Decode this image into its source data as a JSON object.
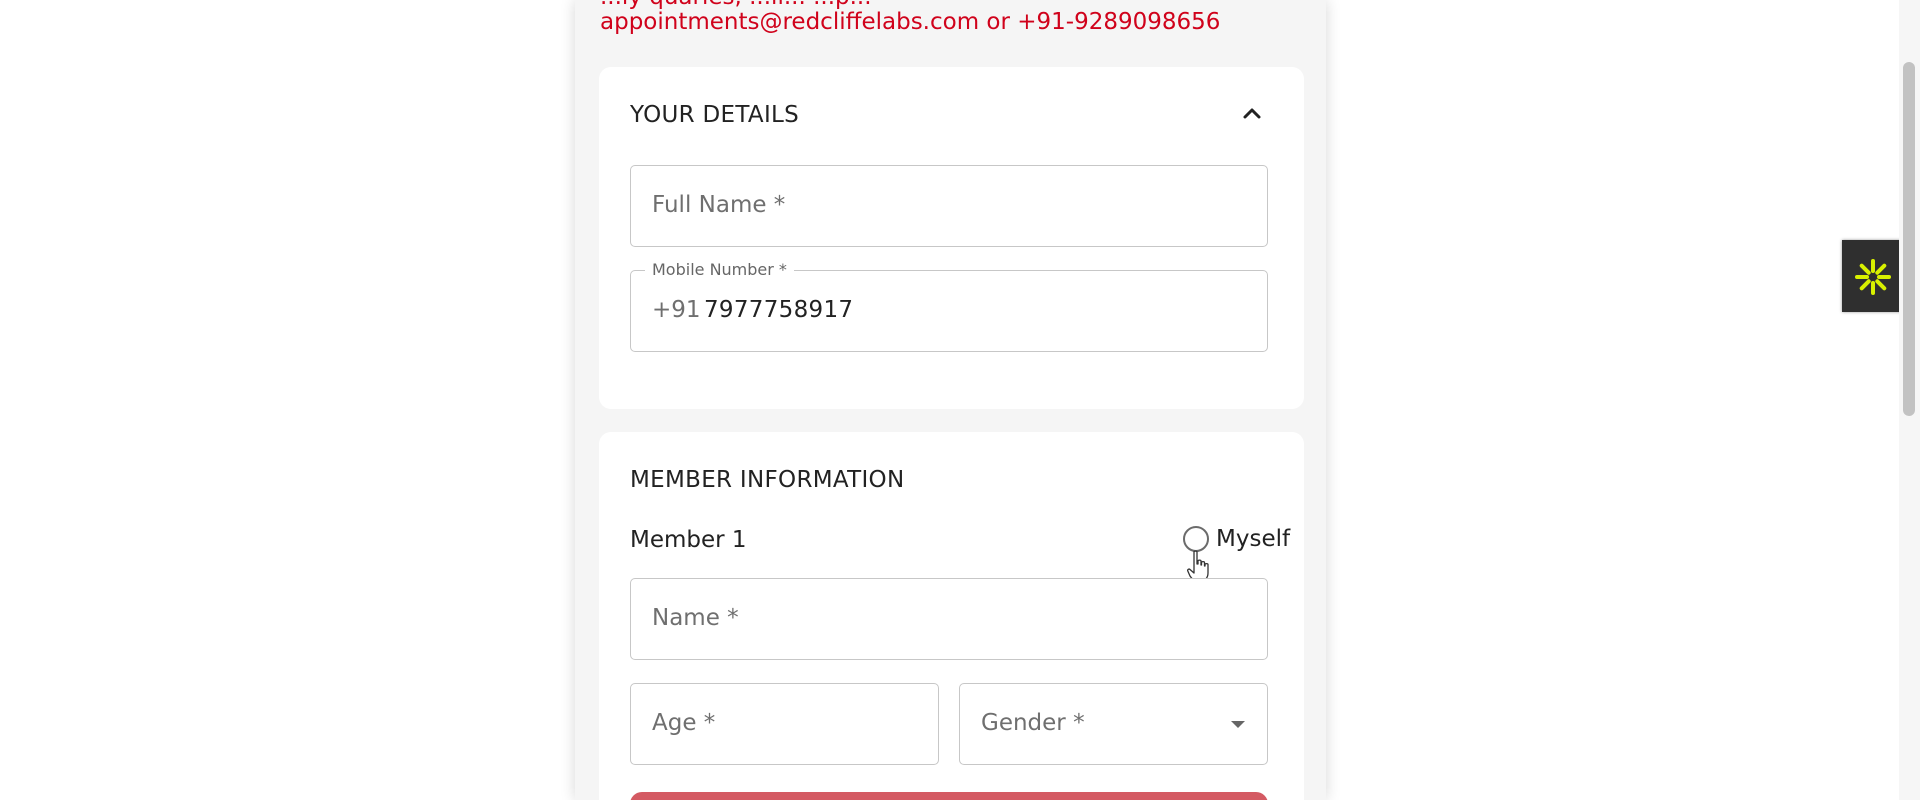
{
  "contact": {
    "partial_line": "...ly quaries, ...ll... ...p...",
    "line": "appointments@redcliffelabs.com or +91-9289098656"
  },
  "your_details": {
    "title": "YOUR DETAILS",
    "full_name_placeholder": "Full Name *",
    "mobile_label": "Mobile Number *",
    "mobile_prefix": "+91",
    "mobile_value": "7977758917"
  },
  "member_information": {
    "title": "MEMBER INFORMATION",
    "member_label": "Member 1",
    "myself_label": "Myself",
    "name_placeholder": "Name *",
    "age_placeholder": "Age *",
    "gender_placeholder": "Gender *"
  },
  "colors": {
    "accent_red": "#d0021b",
    "button_red": "#d45a63",
    "widget_icon": "#d8f000"
  },
  "icons": {
    "collapse": "chevron-up-icon",
    "dropdown": "dropdown-arrow-icon",
    "cursor": "hand-pointer-icon",
    "widget": "asterisk-accessibility-icon"
  }
}
